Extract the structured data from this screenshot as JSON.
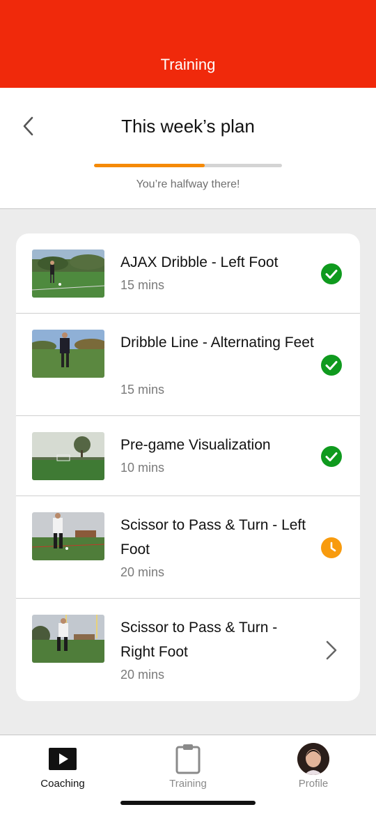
{
  "top_bar": {
    "title": "Training",
    "color": "#f0290b"
  },
  "header": {
    "back_icon": "chevron-left-icon",
    "title": "This week’s plan",
    "progress": {
      "fraction": 0.59,
      "color": "#f58a07"
    },
    "progress_text": "You’re halfway there!"
  },
  "drills": [
    {
      "title": "AJAX Dribble - Left Foot",
      "duration": "15 mins",
      "status": "completed",
      "status_icon": "check-circle-icon"
    },
    {
      "title": "Dribble Line - Alternating Feet",
      "duration": "15 mins",
      "status": "completed",
      "status_icon": "check-circle-icon"
    },
    {
      "title": "Pre-game Visualization",
      "duration": "10 mins",
      "status": "completed",
      "status_icon": "check-circle-icon"
    },
    {
      "title": "Scissor to Pass & Turn - Left Foot",
      "duration": "20 mins",
      "status": "in-progress",
      "status_icon": "clock-icon"
    },
    {
      "title": "Scissor to Pass & Turn - Right Foot",
      "duration": "20 mins",
      "status": "not-started",
      "status_icon": "chevron-right-icon"
    }
  ],
  "status_colors": {
    "completed": "#0f9a1e",
    "in-progress": "#f89b0e"
  },
  "tabs": [
    {
      "label": "Coaching",
      "icon": "play-icon",
      "active": true
    },
    {
      "label": "Training",
      "icon": "clipboard-icon",
      "active": false
    },
    {
      "label": "Profile",
      "icon": "avatar",
      "active": false
    }
  ]
}
